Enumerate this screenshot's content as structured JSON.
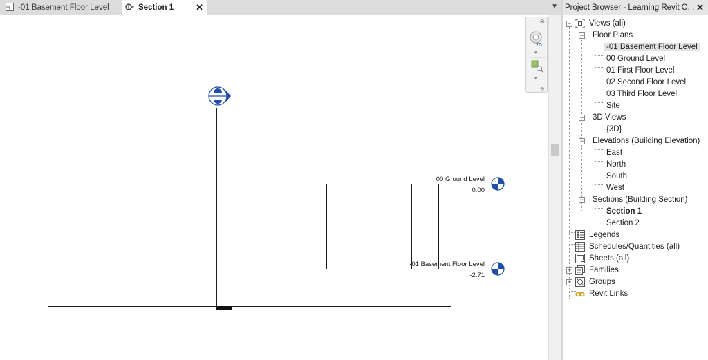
{
  "tabs": [
    {
      "label": "-01 Basement Floor Level",
      "active": false
    },
    {
      "label": "Section 1",
      "active": true
    }
  ],
  "drawing": {
    "levels": [
      {
        "name": "00 Ground Level",
        "elevation": "0.00"
      },
      {
        "name": "-01 Basement Floor Level",
        "elevation": "-2.71"
      }
    ],
    "nav_label": "2D"
  },
  "browser": {
    "title": "Project Browser - Learning Revit O...",
    "tree": {
      "views_all": "Views (all)",
      "floor_plans": "Floor Plans",
      "floor_plan_items": [
        "-01 Basement Floor Level",
        "00 Ground Level",
        "01 First Floor Level",
        "02 Second Floor Level",
        "03 Third Floor Level",
        "Site"
      ],
      "views_3d": "3D Views",
      "views_3d_items": [
        "{3D}"
      ],
      "elevations": "Elevations (Building Elevation)",
      "elevation_items": [
        "East",
        "North",
        "South",
        "West"
      ],
      "sections": "Sections (Building Section)",
      "section_items": [
        "Section 1",
        "Section 2"
      ],
      "legends": "Legends",
      "schedules": "Schedules/Quantities (all)",
      "sheets": "Sheets (all)",
      "families": "Families",
      "groups": "Groups",
      "revit_links": "Revit Links"
    }
  },
  "colors": {
    "accent": "#1f4fa8",
    "selected": "#e3e3e3"
  }
}
